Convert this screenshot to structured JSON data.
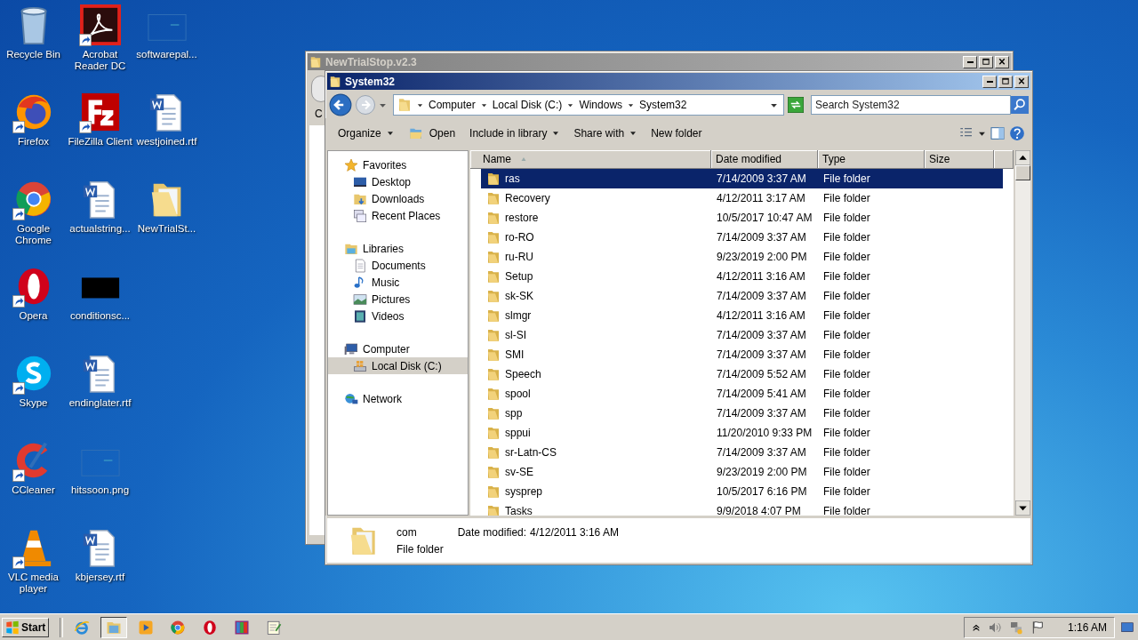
{
  "desktop_icons": [
    {
      "label": "Recycle Bin",
      "kind": "recycle-bin",
      "shortcut": false
    },
    {
      "label": "Firefox",
      "kind": "firefox",
      "shortcut": true
    },
    {
      "label": "Google Chrome",
      "kind": "chrome",
      "shortcut": true
    },
    {
      "label": "Opera",
      "kind": "opera",
      "shortcut": true
    },
    {
      "label": "Skype",
      "kind": "skype",
      "shortcut": true
    },
    {
      "label": "CCleaner",
      "kind": "ccleaner",
      "shortcut": true
    },
    {
      "label": "VLC media player",
      "kind": "vlc",
      "shortcut": true
    },
    {
      "label": "Acrobat Reader DC",
      "kind": "acrobat",
      "shortcut": true
    },
    {
      "label": "FileZilla Client",
      "kind": "filezilla",
      "shortcut": true
    },
    {
      "label": "actualstring...",
      "kind": "word",
      "shortcut": false
    },
    {
      "label": "conditionsc...",
      "kind": "black-image",
      "shortcut": false
    },
    {
      "label": "endinglater.rtf",
      "kind": "word",
      "shortcut": false
    },
    {
      "label": "hitssoon.png",
      "kind": "blank-image",
      "shortcut": false
    },
    {
      "label": "kbjersey.rtf",
      "kind": "word",
      "shortcut": false
    },
    {
      "label": "softwarepal...",
      "kind": "blank-image",
      "shortcut": false
    },
    {
      "label": "westjoined.rtf",
      "kind": "word",
      "shortcut": false
    },
    {
      "label": "NewTrialSt...",
      "kind": "folder",
      "shortcut": false
    }
  ],
  "back_window": {
    "title": "NewTrialStop.v2.3",
    "partial_text": "C"
  },
  "window": {
    "title": "System32",
    "breadcrumbs": [
      "Computer",
      "Local Disk (C:)",
      "Windows",
      "System32"
    ],
    "search": {
      "placeholder": "Search System32"
    },
    "toolbar": [
      {
        "label": "Organize",
        "dropdown": true,
        "icon": false
      },
      {
        "label": "Open",
        "dropdown": false,
        "icon": true
      },
      {
        "label": "Include in library",
        "dropdown": true,
        "icon": false
      },
      {
        "label": "Share with",
        "dropdown": true,
        "icon": false
      },
      {
        "label": "New folder",
        "dropdown": false,
        "icon": false
      }
    ],
    "nav": [
      {
        "label": "Favorites",
        "kind": "star",
        "selected": false,
        "children": [
          {
            "label": "Desktop",
            "kind": "desktop",
            "selected": false
          },
          {
            "label": "Downloads",
            "kind": "downloads",
            "selected": false
          },
          {
            "label": "Recent Places",
            "kind": "recent",
            "selected": false
          }
        ]
      },
      {
        "label": "Libraries",
        "kind": "libraries",
        "selected": false,
        "children": [
          {
            "label": "Documents",
            "kind": "document",
            "selected": false
          },
          {
            "label": "Music",
            "kind": "music",
            "selected": false
          },
          {
            "label": "Pictures",
            "kind": "pictures",
            "selected": false
          },
          {
            "label": "Videos",
            "kind": "videos",
            "selected": false
          }
        ]
      },
      {
        "label": "Computer",
        "kind": "computer",
        "selected": false,
        "children": [
          {
            "label": "Local Disk (C:)",
            "kind": "disk",
            "selected": true
          }
        ]
      },
      {
        "label": "Network",
        "kind": "network",
        "selected": false
      }
    ],
    "columns": [
      {
        "label": "Name",
        "sorted": true
      },
      {
        "label": "Date modified",
        "sorted": false
      },
      {
        "label": "Type",
        "sorted": false
      },
      {
        "label": "Size",
        "sorted": false
      }
    ],
    "rows": [
      {
        "name": "ras",
        "date": "7/14/2009 3:37 AM",
        "type": "File folder",
        "selected": true
      },
      {
        "name": "Recovery",
        "date": "4/12/2011 3:17 AM",
        "type": "File folder",
        "selected": false
      },
      {
        "name": "restore",
        "date": "10/5/2017 10:47 AM",
        "type": "File folder",
        "selected": false
      },
      {
        "name": "ro-RO",
        "date": "7/14/2009 3:37 AM",
        "type": "File folder",
        "selected": false
      },
      {
        "name": "ru-RU",
        "date": "9/23/2019 2:00 PM",
        "type": "File folder",
        "selected": false
      },
      {
        "name": "Setup",
        "date": "4/12/2011 3:16 AM",
        "type": "File folder",
        "selected": false
      },
      {
        "name": "sk-SK",
        "date": "7/14/2009 3:37 AM",
        "type": "File folder",
        "selected": false
      },
      {
        "name": "slmgr",
        "date": "4/12/2011 3:16 AM",
        "type": "File folder",
        "selected": false
      },
      {
        "name": "sl-SI",
        "date": "7/14/2009 3:37 AM",
        "type": "File folder",
        "selected": false
      },
      {
        "name": "SMI",
        "date": "7/14/2009 3:37 AM",
        "type": "File folder",
        "selected": false
      },
      {
        "name": "Speech",
        "date": "7/14/2009 5:52 AM",
        "type": "File folder",
        "selected": false
      },
      {
        "name": "spool",
        "date": "7/14/2009 5:41 AM",
        "type": "File folder",
        "selected": false
      },
      {
        "name": "spp",
        "date": "7/14/2009 3:37 AM",
        "type": "File folder",
        "selected": false
      },
      {
        "name": "sppui",
        "date": "11/20/2010 9:33 PM",
        "type": "File folder",
        "selected": false
      },
      {
        "name": "sr-Latn-CS",
        "date": "7/14/2009 3:37 AM",
        "type": "File folder",
        "selected": false
      },
      {
        "name": "sv-SE",
        "date": "9/23/2019 2:00 PM",
        "type": "File folder",
        "selected": false
      },
      {
        "name": "sysprep",
        "date": "10/5/2017 6:16 PM",
        "type": "File folder",
        "selected": false
      },
      {
        "name": "Tasks",
        "date": "9/9/2018 4:07 PM",
        "type": "File folder",
        "selected": false
      }
    ],
    "details": {
      "name": "com",
      "date_label": "Date modified:",
      "date": "4/12/2011 3:16 AM",
      "type": "File folder"
    }
  },
  "taskbar": {
    "start": "Start",
    "items": [
      {
        "kind": "ie",
        "selected": false
      },
      {
        "kind": "explorer",
        "selected": true
      },
      {
        "kind": "media",
        "selected": false
      },
      {
        "kind": "chrome",
        "selected": false
      },
      {
        "kind": "opera",
        "selected": false
      },
      {
        "kind": "winrar",
        "selected": false
      },
      {
        "kind": "notepad",
        "selected": false
      }
    ],
    "clock": "1:16 AM"
  }
}
